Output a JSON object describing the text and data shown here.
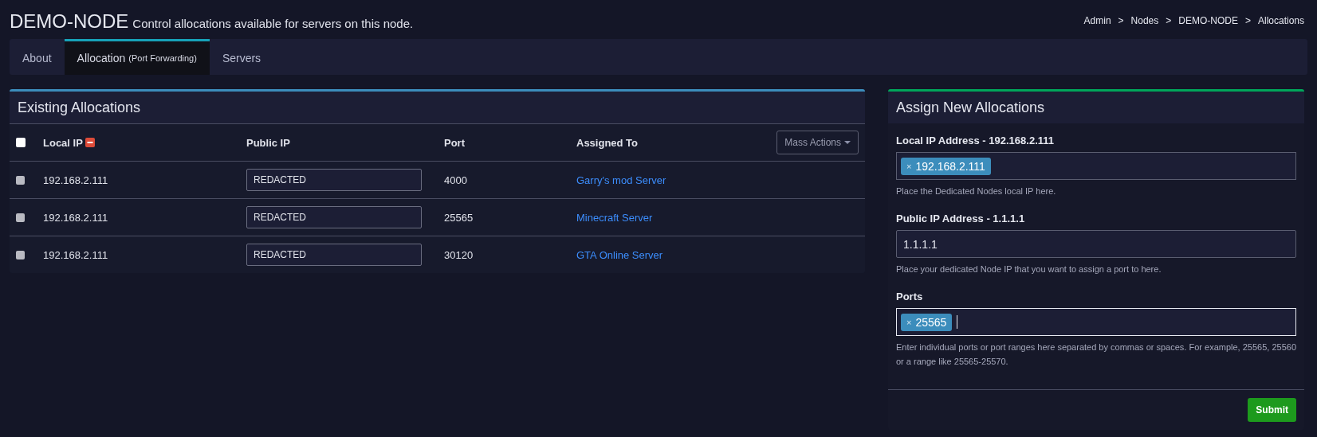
{
  "header": {
    "title": "DEMO-NODE",
    "subtitle": "Control allocations available for servers on this node.",
    "breadcrumbs": [
      "Admin",
      "Nodes",
      "DEMO-NODE",
      "Allocations"
    ],
    "separator": ">"
  },
  "tabs": [
    {
      "label": "About",
      "selected": false
    },
    {
      "label": "Allocation",
      "note": "(Port Forwarding)",
      "selected": true
    },
    {
      "label": "Servers",
      "selected": false
    }
  ],
  "existing": {
    "title": "Existing Allocations",
    "select_all": {
      "checked": false
    },
    "columns": [
      "Local IP",
      "Public IP",
      "Port",
      "Assigned To"
    ],
    "mass_actions": "Mass Actions",
    "rows": [
      {
        "checked": false,
        "local_ip": "192.168.2.111",
        "public_ip": "REDACTED",
        "port": "4000",
        "assigned_to": "Garry's mod Server"
      },
      {
        "checked": false,
        "local_ip": "192.168.2.111",
        "public_ip": "REDACTED",
        "port": "25565",
        "assigned_to": "Minecraft Server"
      },
      {
        "checked": false,
        "local_ip": "192.168.2.111",
        "public_ip": "REDACTED",
        "port": "30120",
        "assigned_to": "GTA Online Server"
      }
    ]
  },
  "assign": {
    "title": "Assign New Allocations",
    "fields": [
      {
        "kind": "tags",
        "label": "Local IP Address - 192.168.2.111",
        "tags": [
          "192.168.2.111"
        ],
        "remove": "×",
        "focused": false,
        "help": "Place the Dedicated Nodes local IP here."
      },
      {
        "kind": "text",
        "label": "Public IP Address - 1.1.1.1",
        "value": "1.1.1.1",
        "help": "Place your dedicated Node IP that you want to assign a port to here."
      },
      {
        "kind": "tags",
        "label": "Ports",
        "tags": [
          "25565"
        ],
        "remove": "×",
        "focused": true,
        "help": "Enter individual ports or port ranges here separated by commas or spaces. For example, 25565, 25560 or a range like 25565-25570."
      }
    ],
    "submit": "Submit"
  }
}
